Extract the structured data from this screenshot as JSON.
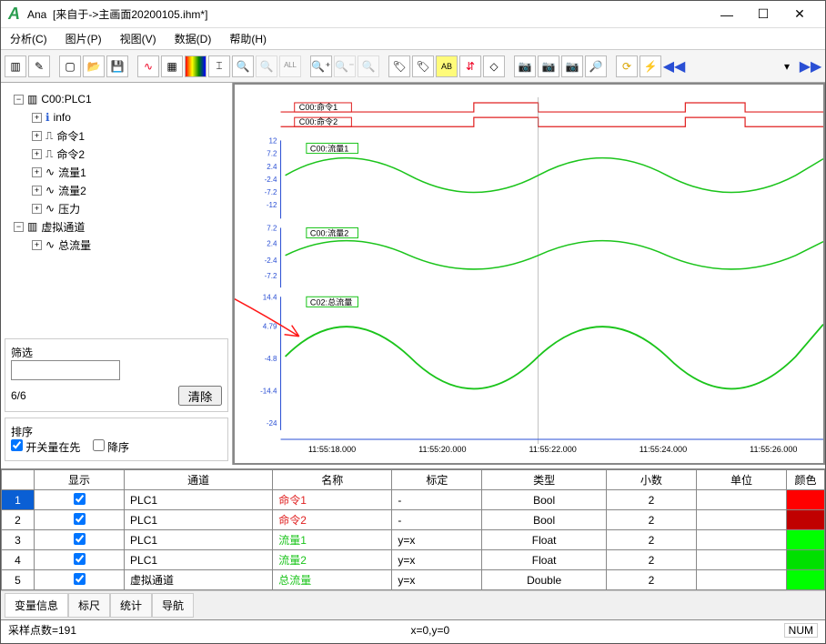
{
  "window": {
    "app": "Ana",
    "title": "[来自于->主画面20200105.ihm*]"
  },
  "menu": {
    "analyze": "分析(C)",
    "image": "图片(P)",
    "view": "视图(V)",
    "data": "数据(D)",
    "help": "帮助(H)"
  },
  "tree": {
    "root1": "C00:PLC1",
    "items1": [
      "info",
      "命令1",
      "命令2",
      "流量1",
      "流量2",
      "压力"
    ],
    "root2": "虚拟通道",
    "items2": [
      "总流量"
    ]
  },
  "filter": {
    "label": "筛选",
    "count": "6/6",
    "clear": "清除"
  },
  "sort": {
    "label": "排序",
    "switch_first": "开关量在先",
    "desc": "降序"
  },
  "chart_data": {
    "type": "line",
    "xlabel": "",
    "ylabel": "",
    "x_ticks": [
      "11:55:18.000",
      "11:55:20.000",
      "11:55:22.000",
      "11:55:24.000",
      "11:55:26.000"
    ],
    "digital": [
      {
        "name": "C00:命令1",
        "color": "#e02020"
      },
      {
        "name": "C00:命令2",
        "color": "#e02020"
      }
    ],
    "series": [
      {
        "name": "C00:流量1",
        "color": "#1bc41b",
        "ylim": [
          -12,
          12
        ],
        "ticks": [
          12,
          7.2,
          2.4,
          -2.4,
          -7.2,
          -12
        ]
      },
      {
        "name": "C00:流量2",
        "color": "#1bc41b",
        "ylim": [
          -7.2,
          7.2
        ],
        "ticks": [
          7.2,
          2.4,
          -2.4,
          -7.2
        ]
      },
      {
        "name": "C02:总流量",
        "color": "#1bc41b",
        "ylim": [
          -24,
          14.4
        ],
        "ticks": [
          14.4,
          4.79,
          -4.8,
          -14.4,
          -24
        ]
      }
    ]
  },
  "table": {
    "headers": [
      "",
      "显示",
      "通道",
      "名称",
      "标定",
      "类型",
      "小数",
      "单位",
      "颜色"
    ],
    "rows": [
      {
        "n": "1",
        "show": true,
        "ch": "PLC1",
        "name": "命令1",
        "name_color": "#e02020",
        "cal": "-",
        "type": "Bool",
        "dec": "2",
        "unit": "",
        "color": "#ff0000"
      },
      {
        "n": "2",
        "show": true,
        "ch": "PLC1",
        "name": "命令2",
        "name_color": "#e02020",
        "cal": "-",
        "type": "Bool",
        "dec": "2",
        "unit": "",
        "color": "#c00000"
      },
      {
        "n": "3",
        "show": true,
        "ch": "PLC1",
        "name": "流量1",
        "name_color": "#1bc41b",
        "cal": "y=x",
        "type": "Float",
        "dec": "2",
        "unit": "",
        "color": "#00ff00"
      },
      {
        "n": "4",
        "show": true,
        "ch": "PLC1",
        "name": "流量2",
        "name_color": "#1bc41b",
        "cal": "y=x",
        "type": "Float",
        "dec": "2",
        "unit": "",
        "color": "#00e000"
      },
      {
        "n": "5",
        "show": true,
        "ch": "虚拟通道",
        "name": "总流量",
        "name_color": "#1bc41b",
        "cal": "y=x",
        "type": "Double",
        "dec": "2",
        "unit": "",
        "color": "#00ff00"
      }
    ]
  },
  "tabs": [
    "变量信息",
    "标尺",
    "统计",
    "导航"
  ],
  "status": {
    "left": "采样点数=191",
    "mid": "x=0,y=0",
    "right": "NUM"
  }
}
